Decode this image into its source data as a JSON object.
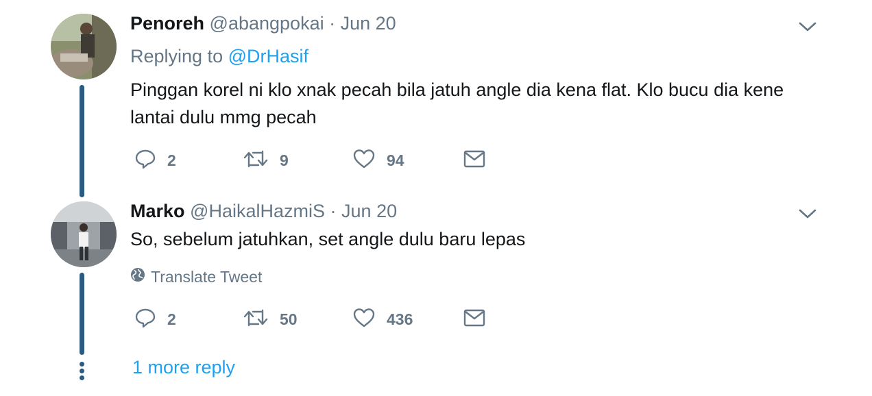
{
  "tweets": [
    {
      "name": "Penoreh",
      "handle": "@abangpokai",
      "separator": "·",
      "date": "Jun 20",
      "replying_label": "Replying to",
      "replying_to": "@DrHasif",
      "text": "Pinggan korel ni klo xnak pecah bila jatuh angle dia kena flat. Klo bucu dia kene lantai dulu mmg pecah",
      "replies": "2",
      "retweets": "9",
      "likes": "94"
    },
    {
      "name": "Marko",
      "handle": "@HaikalHazmiS",
      "separator": "·",
      "date": "Jun 20",
      "text": "So, sebelum jatuhkan, set angle dulu baru lepas",
      "translate_label": "Translate Tweet",
      "replies": "2",
      "retweets": "50",
      "likes": "436"
    }
  ],
  "more_replies": "1 more reply",
  "colors": {
    "thread_line": "#2b5a83",
    "link": "#1da1f2",
    "secondary": "#657786",
    "text": "#14171a"
  },
  "icons": [
    "chevron-down-icon",
    "reply-icon",
    "retweet-icon",
    "like-icon",
    "message-icon",
    "globe-icon"
  ]
}
